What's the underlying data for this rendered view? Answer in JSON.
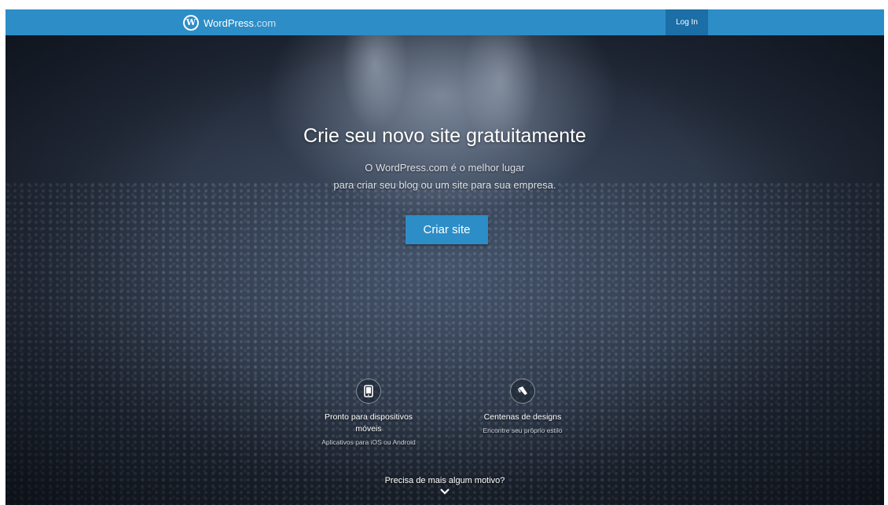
{
  "header": {
    "brand_main": "WordPress",
    "brand_domain": ".com",
    "logo_icon": "wordpress-logo-icon",
    "login_label": "Log In",
    "accent_color": "#2d8dc7"
  },
  "hero": {
    "headline": "Crie seu novo site gratuitamente",
    "subline_1": "O WordPress.com é o melhor lugar",
    "subline_2": "para criar seu blog ou um site para sua empresa.",
    "cta_label": "Criar site"
  },
  "features": [
    {
      "icon": "mobile-device-icon",
      "title_1": "Pronto para dispositivos",
      "title_2": "móveis",
      "subtitle": "Aplicativos para iOS ou Android"
    },
    {
      "icon": "paintbrush-icon",
      "title_1": "Centenas de designs",
      "title_2": "",
      "subtitle": "Encontre seu próprio estilo"
    }
  ],
  "more": {
    "label": "Precisa de mais algum motivo?",
    "icon": "chevron-down-icon"
  }
}
